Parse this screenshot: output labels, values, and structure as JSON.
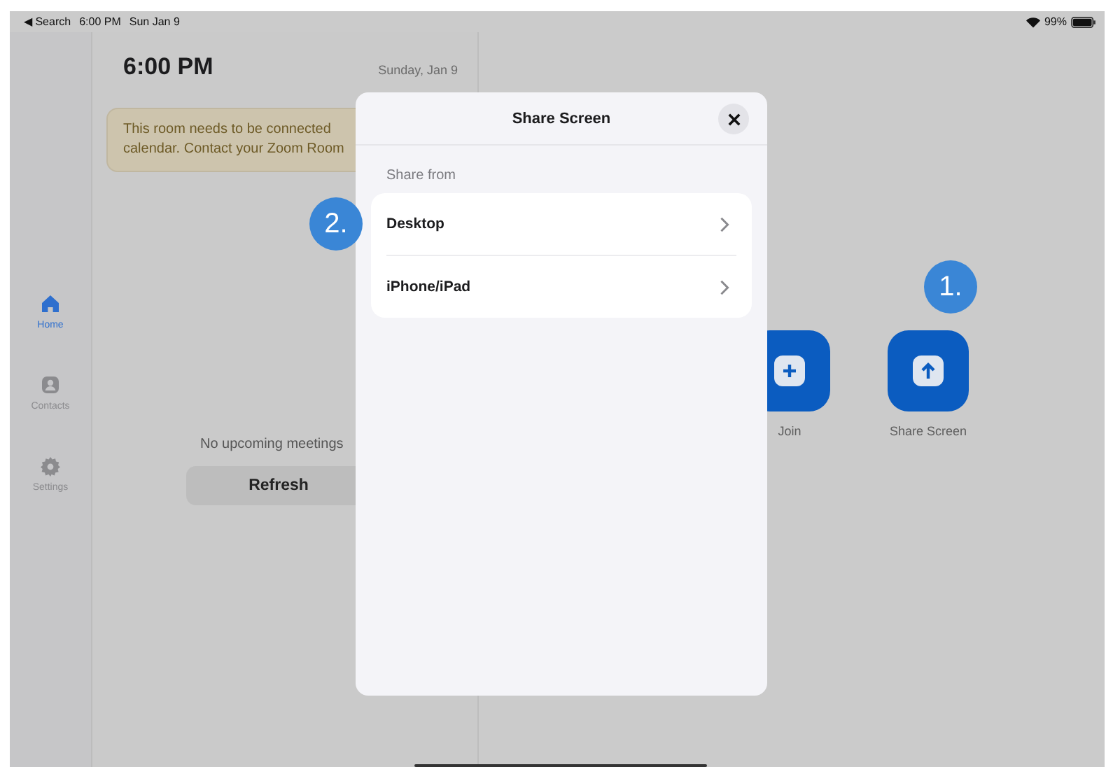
{
  "status_bar": {
    "back_label": "◀ Search",
    "time": "6:00 PM",
    "date": "Sun Jan 9",
    "battery": "99%"
  },
  "sidebar": {
    "items": [
      {
        "label": "Home",
        "kind": "home",
        "selected": true
      },
      {
        "label": "Contacts",
        "kind": "contacts",
        "selected": false
      },
      {
        "label": "Settings",
        "kind": "settings",
        "selected": false
      }
    ]
  },
  "home_panel": {
    "time": "6:00 PM",
    "date": "Sunday, Jan 9",
    "notice": [
      "This room needs to be connected",
      "calendar. Contact your Zoom Room"
    ],
    "empty_message": "No upcoming meetings",
    "refresh_button": "Refresh"
  },
  "actions": [
    {
      "label": "Join",
      "kind": "join"
    },
    {
      "label": "Share Screen",
      "kind": "share"
    }
  ],
  "dialog": {
    "title": "Share Screen",
    "section_label": "Share from",
    "options": [
      {
        "label": "Desktop"
      },
      {
        "label": "iPhone/iPad"
      }
    ]
  },
  "callouts": [
    {
      "label": "2."
    },
    {
      "label": "1."
    }
  ]
}
